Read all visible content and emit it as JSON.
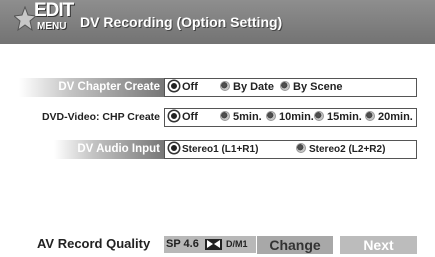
{
  "header": {
    "logo_top": "EDIT",
    "logo_bottom": "MENU",
    "title": "DV Recording (Option Setting)"
  },
  "settings": [
    {
      "label": "DV Chapter Create",
      "options": [
        "Off",
        "By Date",
        "By Scene"
      ],
      "selected": "Off"
    },
    {
      "label": "DVD-Video: CHP Create",
      "options": [
        "Off",
        "5min.",
        "10min.",
        "15min.",
        "20min."
      ],
      "selected": "Off"
    },
    {
      "label": "DV Audio Input",
      "options": [
        "Stereo1 (L1+R1)",
        "Stereo2 (L2+R2)"
      ],
      "selected": "Stereo1 (L1+R1)"
    }
  ],
  "footer": {
    "quality_label": "AV Record Quality",
    "quality_value": "SP 4.6",
    "quality_mode": "D/M1",
    "change_label": "Change",
    "next_label": "Next"
  },
  "colors": {
    "header_bg": "#7f7f7f",
    "button_bg": "#bcbcbc",
    "quality_bg": "#b8b8b8"
  },
  "icons": [
    "edit-menu-logo-icon",
    "radio-selected-icon",
    "radio-unselected-icon",
    "dvd-icon"
  ]
}
